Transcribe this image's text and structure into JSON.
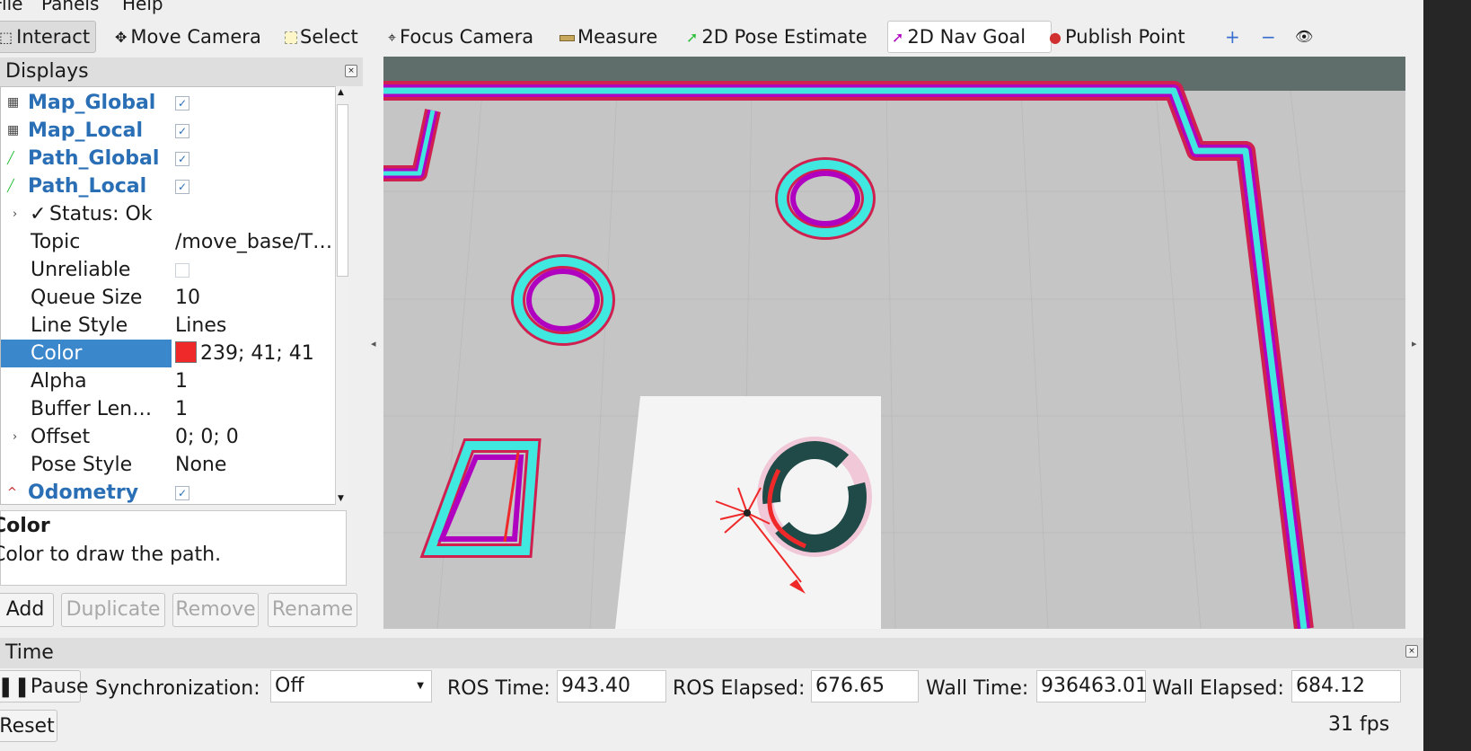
{
  "menu": [
    "File",
    "Panels",
    "Help"
  ],
  "toolbar": {
    "tools": [
      {
        "label": "Interact",
        "icon": "cursor-icon"
      },
      {
        "label": "Move Camera",
        "icon": "move-icon"
      },
      {
        "label": "Select",
        "icon": "select-box-icon"
      },
      {
        "label": "Focus Camera",
        "icon": "focus-icon"
      },
      {
        "label": "Measure",
        "icon": "ruler-icon"
      },
      {
        "label": "2D Pose Estimate",
        "icon": "green-arrow-icon"
      },
      {
        "label": "2D Nav Goal",
        "icon": "purple-arrow-icon"
      },
      {
        "label": "Publish Point",
        "icon": "map-pin-icon"
      }
    ],
    "icons": [
      "plus-icon",
      "minus-icon",
      "eye-icon"
    ]
  },
  "displays": {
    "title": "Displays",
    "rows": [
      {
        "label": "Map_Global",
        "checked": true
      },
      {
        "label": "Map_Local",
        "checked": true
      },
      {
        "label": "Path_Global",
        "checked": true
      },
      {
        "label": "Path_Local",
        "checked": true
      },
      {
        "label": "Status: Ok"
      },
      {
        "label": "Topic",
        "value": "/move_base/T…"
      },
      {
        "label": "Unreliable",
        "checked": false
      },
      {
        "label": "Queue Size",
        "value": "10"
      },
      {
        "label": "Line Style",
        "value": "Lines"
      },
      {
        "label": "Color",
        "value": "239; 41; 41",
        "swatch": "#ef2929"
      },
      {
        "label": "Alpha",
        "value": "1"
      },
      {
        "label": "Buffer Len…",
        "value": "1"
      },
      {
        "label": "Offset",
        "value": "0; 0; 0"
      },
      {
        "label": "Pose Style",
        "value": "None"
      },
      {
        "label": "Odometry",
        "checked": true
      }
    ],
    "description_title": "Color",
    "description_text": "Color to draw the path.",
    "buttons": [
      "Add",
      "Duplicate",
      "Remove",
      "Rename"
    ]
  },
  "time": {
    "title": "Time",
    "pause_label": "Pause",
    "sync_label": "Synchronization:",
    "sync_value": "Off",
    "ros_time_label": "ROS Time:",
    "ros_time": "943.40",
    "ros_elapsed_label": "ROS Elapsed:",
    "ros_elapsed": "676.65",
    "wall_time_label": "Wall Time:",
    "wall_time": "936463.01",
    "wall_elapsed_label": "Wall Elapsed:",
    "wall_elapsed": "684.12",
    "reset_label": "Reset",
    "fps": "31 fps"
  },
  "colors": {
    "wall_cyan": "#40e8e0",
    "wall_magenta": "#b000c0",
    "wall_red": "#d02050",
    "path_red": "#ef2929",
    "selection_blue": "#3a87cc"
  }
}
